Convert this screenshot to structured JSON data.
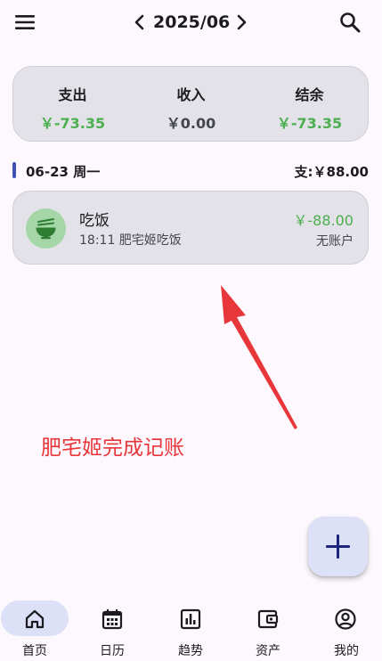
{
  "topbar": {
    "month": "2025/06",
    "menu_icon": "menu-icon",
    "search_icon": "search-icon",
    "prev_icon": "chevron-left-icon",
    "next_icon": "chevron-right-icon"
  },
  "summary": {
    "expense_label": "支出",
    "expense_value": "￥-73.35",
    "income_label": "收入",
    "income_value": "￥0.00",
    "balance_label": "结余",
    "balance_value": "￥-73.35"
  },
  "day_group": {
    "date_label": "06-23 周一",
    "total_label": "支:￥88.00"
  },
  "transactions": [
    {
      "category": "吃饭",
      "detail": "18:11 肥宅姬吃饭",
      "amount": "￥-88.00",
      "account": "无账户",
      "icon": "rice-bowl-icon"
    }
  ],
  "annotation": {
    "text": "肥宅姬完成记账",
    "color": "#e8373a"
  },
  "fab": {
    "icon": "plus-icon"
  },
  "bottom_nav": {
    "items": [
      {
        "label": "首页",
        "icon": "home-icon",
        "active": true
      },
      {
        "label": "日历",
        "icon": "calendar-icon",
        "active": false
      },
      {
        "label": "趋势",
        "icon": "bar-chart-icon",
        "active": false
      },
      {
        "label": "资产",
        "icon": "wallet-icon",
        "active": false
      },
      {
        "label": "我的",
        "icon": "account-icon",
        "active": false
      }
    ]
  },
  "colors": {
    "accent": "#3f51b5",
    "positive_green": "#4caf50",
    "card_bg": "#e3e2e8",
    "nav_active_bg": "#dde1f7"
  }
}
